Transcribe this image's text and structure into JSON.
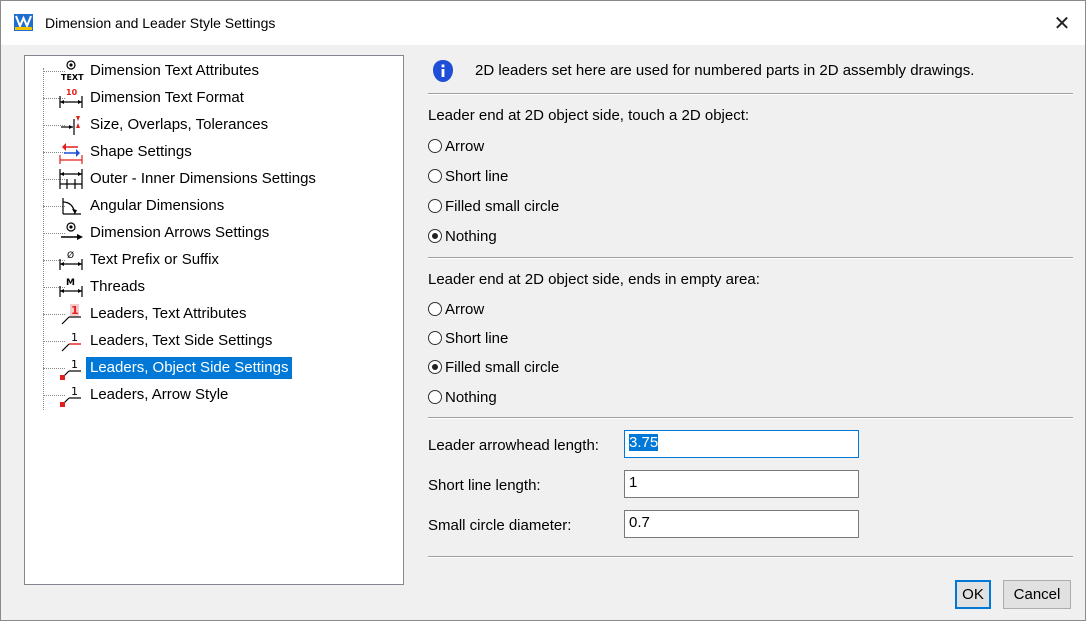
{
  "window": {
    "title": "Dimension and Leader Style Settings",
    "close_glyph": "✕"
  },
  "tree": {
    "items": [
      {
        "label": "Dimension Text Attributes",
        "icon": "dimension-text-attributes-icon",
        "selected": false
      },
      {
        "label": "Dimension Text Format",
        "icon": "dimension-text-format-icon",
        "selected": false
      },
      {
        "label": "Size, Overlaps, Tolerances",
        "icon": "tolerances-icon",
        "selected": false
      },
      {
        "label": "Shape Settings",
        "icon": "shape-settings-icon",
        "selected": false
      },
      {
        "label": "Outer - Inner Dimensions Settings",
        "icon": "outer-inner-dimensions-icon",
        "selected": false
      },
      {
        "label": "Angular Dimensions",
        "icon": "angular-dimensions-icon",
        "selected": false
      },
      {
        "label": "Dimension Arrows Settings",
        "icon": "dimension-arrows-icon",
        "selected": false
      },
      {
        "label": "Text Prefix or Suffix",
        "icon": "text-prefix-suffix-icon",
        "selected": false
      },
      {
        "label": "Threads",
        "icon": "threads-icon",
        "selected": false
      },
      {
        "label": "Leaders, Text Attributes",
        "icon": "leaders-text-attributes-icon",
        "selected": false
      },
      {
        "label": "Leaders, Text Side Settings",
        "icon": "leaders-text-side-icon",
        "selected": false
      },
      {
        "label": "Leaders, Object Side Settings",
        "icon": "leaders-object-side-icon",
        "selected": true
      },
      {
        "label": "Leaders, Arrow Style",
        "icon": "leaders-arrow-style-icon",
        "selected": false
      }
    ],
    "icon_texts": {
      "text": "TEXT",
      "ten": "10",
      "phi": "Ø",
      "m": "M",
      "one": "1"
    }
  },
  "panel": {
    "info": "2D leaders set here are used for numbered parts in 2D assembly drawings.",
    "group1": {
      "label": "Leader end at 2D object side, touch a 2D object:",
      "options": [
        "Arrow",
        "Short line",
        "Filled small circle",
        "Nothing"
      ],
      "selected": "Nothing"
    },
    "group2": {
      "label": "Leader end at 2D object side, ends in empty area:",
      "options": [
        "Arrow",
        "Short line",
        "Filled small circle",
        "Nothing"
      ],
      "selected": "Filled small circle"
    },
    "fields": {
      "arrowhead_label": "Leader arrowhead length:",
      "arrowhead_value": "3.75",
      "shortline_label": "Short line length:",
      "shortline_value": "1",
      "circle_label": "Small circle diameter:",
      "circle_value": "0.7"
    }
  },
  "buttons": {
    "ok": "OK",
    "cancel": "Cancel"
  },
  "colors": {
    "accent": "#0078d7",
    "red": "#e0201c",
    "icon_blue": "#1f4fd6"
  }
}
